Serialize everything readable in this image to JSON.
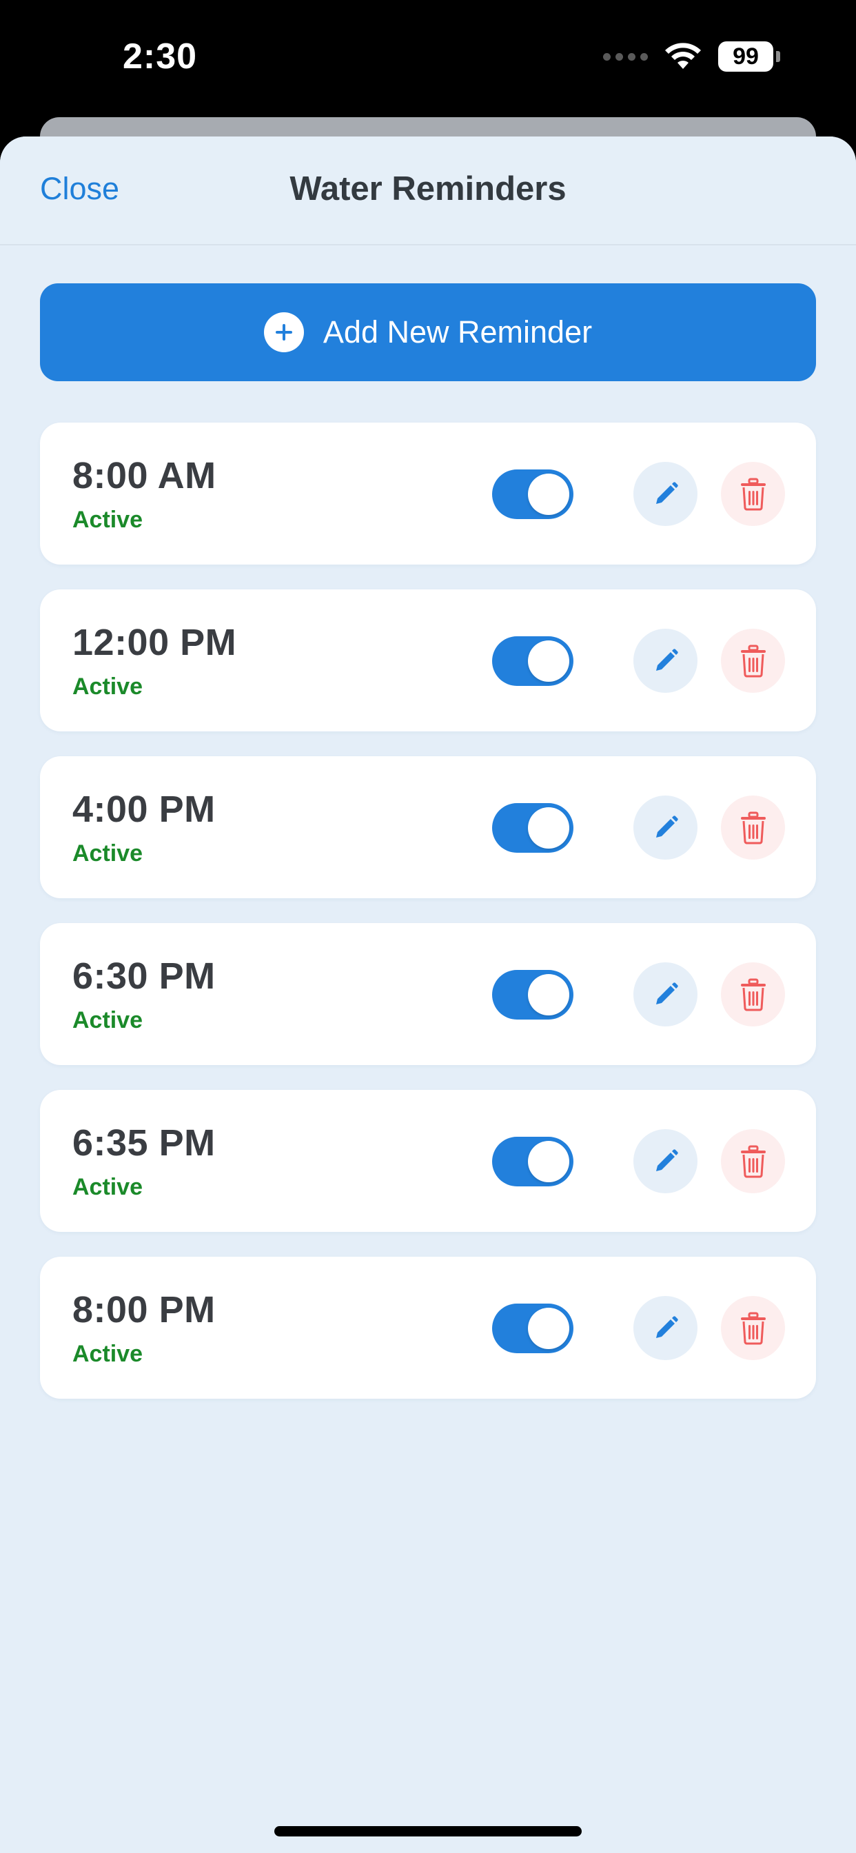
{
  "status_bar": {
    "time": "2:30",
    "battery": "99"
  },
  "nav": {
    "close_label": "Close",
    "title": "Water Reminders"
  },
  "add_button": {
    "label": "Add New Reminder"
  },
  "colors": {
    "accent": "#2280dc",
    "active_status": "#1b8a2a",
    "delete": "#ef5b5b",
    "background": "#e4eef8"
  },
  "reminders": [
    {
      "time": "8:00 AM",
      "status": "Active",
      "enabled": true
    },
    {
      "time": "12:00 PM",
      "status": "Active",
      "enabled": true
    },
    {
      "time": "4:00 PM",
      "status": "Active",
      "enabled": true
    },
    {
      "time": "6:30 PM",
      "status": "Active",
      "enabled": true
    },
    {
      "time": "6:35 PM",
      "status": "Active",
      "enabled": true
    },
    {
      "time": "8:00 PM",
      "status": "Active",
      "enabled": true
    }
  ]
}
